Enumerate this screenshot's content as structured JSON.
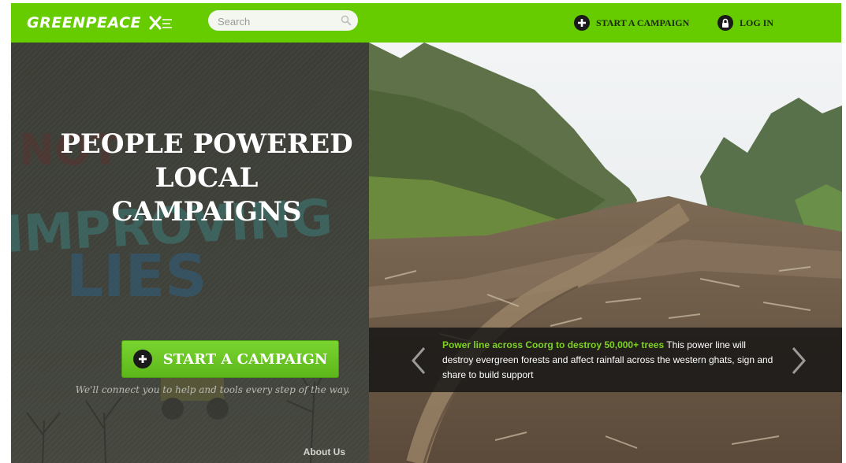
{
  "header": {
    "logo_text": "GREENPEACE",
    "search": {
      "placeholder": "Search",
      "value": ""
    },
    "start_campaign_label": "START A CAMPAIGN",
    "login_label": "LOG IN"
  },
  "hero": {
    "title": "PEOPLE POWERED\nLOCAL CAMPAIGNS",
    "cta_label": "START A CAMPAIGN",
    "tagline": "We'll connect you to help and tools every step of the way.",
    "background_text": [
      "NOT",
      "IMPROVING",
      "LIES"
    ]
  },
  "slider": {
    "headline": "Power line across Coorg to destroy 50,000+ trees",
    "description": "This power line will destroy evergreen forests and affect rainfall across the western ghats, sign and share to build support"
  },
  "footer": {
    "about_label": "About Us"
  },
  "colors": {
    "brand_green": "#66cc00",
    "link_green": "#7ed321",
    "panel_dark": "#3d3f38"
  },
  "icons": [
    "plus-circle-icon",
    "lock-icon",
    "search-icon",
    "chevron-left-icon",
    "chevron-right-icon"
  ]
}
